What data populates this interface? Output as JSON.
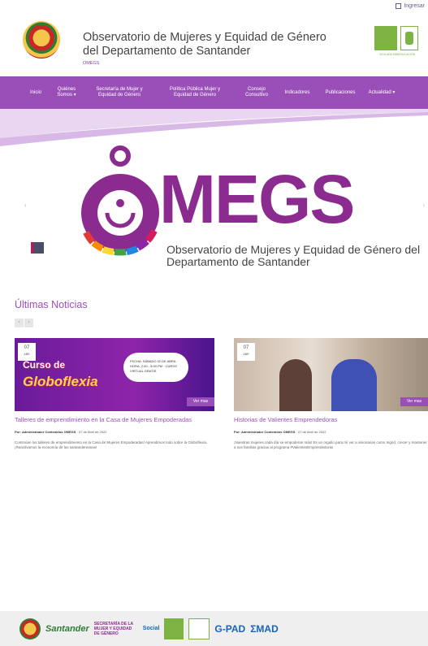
{
  "header": {
    "login": "Ingresar",
    "title": "Observatorio de Mujeres y Equidad de Género del Departamento de Santander",
    "subtitle": "OMEGS",
    "partner_caption": "VIGILADA MINEDUCACIÓN"
  },
  "nav": {
    "items": [
      {
        "label": "Inicio"
      },
      {
        "label": "Quiénes Somos ▾"
      },
      {
        "label": "Secretaría de Mujer y Equidad de Género"
      },
      {
        "label": "Política Pública Mujer y Equidad de Género"
      },
      {
        "label": "Consejo Consultivo"
      },
      {
        "label": "Indicadores"
      },
      {
        "label": "Publicaciones"
      },
      {
        "label": "Actualidad ▾"
      }
    ]
  },
  "hero": {
    "wordmark": "MEGS",
    "caption": "Observatorio de Mujeres y Equidad de Género del Departamento de Santander"
  },
  "news": {
    "title": "Últimas Noticias",
    "cards": [
      {
        "day": "07",
        "month": "ABR",
        "image_text_1": "Curso de",
        "image_text_2": "Globoflexia",
        "image_info": "FECHA: SÁBADO 02 DE ABRIL · HORA: 2:00 - 5:00 PM · CURSO VIRTUAL GRATIS",
        "button": "Ver mas",
        "title": "Talleres de emprendimiento en la Casa de Mujeres Empoderadas",
        "author": "Por: Administrador Contenidos OMEGS",
        "date": "07 de Abril de 2022",
        "excerpt": "Continúan los talleres de emprendimiento en la Casa de Mujeres Empoderadas! Aprendimos todo sobre la Globoflexia. ¡Reactivamos la economía de las santandereanas!"
      },
      {
        "day": "07",
        "month": "ABR",
        "button": "Ver mas",
        "title": "Historias de Valientes Emprendedoras",
        "author": "Por: Administrador Contenidos OMEGS",
        "date": "07 de Abril de 2022",
        "excerpt": "¡Nuestras mujeres cada día se empoderan más! Es un orgullo para mí ver a visionarias como Ingrid, crecer y mantener a sus familias gracias al programa #ValientesEmprendedoras"
      }
    ]
  },
  "footer": {
    "santander_top": "Siempre",
    "santander": "Santander",
    "secretaria": "SECRETARÍA DE LA MUJER Y EQUIDAD DE GÉNERO",
    "social": "Social",
    "gpad": "G-PAD",
    "emad": "ΣMAD"
  }
}
